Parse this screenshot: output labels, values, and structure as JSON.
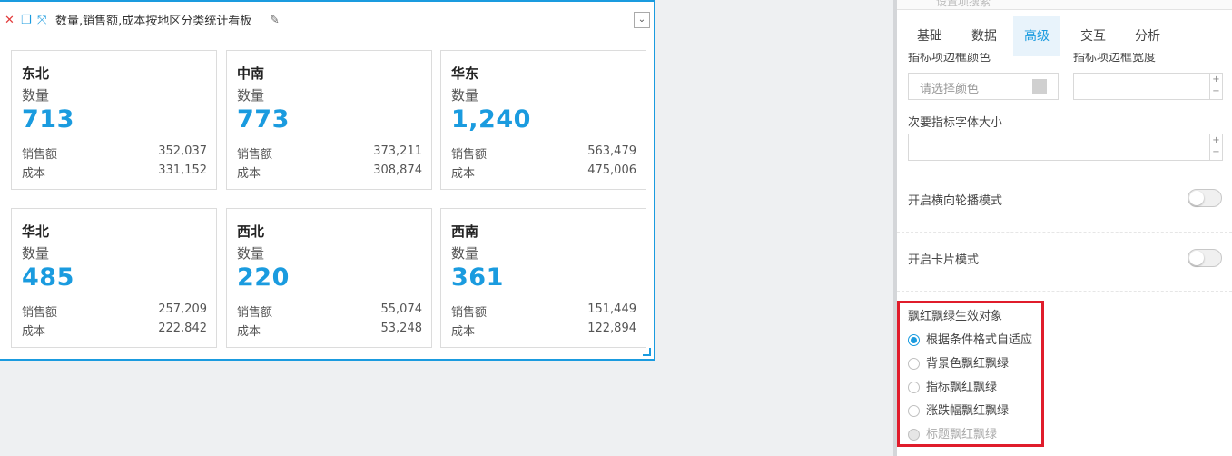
{
  "widget": {
    "title": "数量,销售额,成本按地区分类统计看板",
    "dropdown_glyph": "⌄",
    "cards": [
      {
        "region": "东北",
        "metric_label": "数量",
        "value": "713",
        "row1_label": "销售额",
        "row1_value": "352,037",
        "row2_label": "成本",
        "row2_value": "331,152"
      },
      {
        "region": "中南",
        "metric_label": "数量",
        "value": "773",
        "row1_label": "销售额",
        "row1_value": "373,211",
        "row2_label": "成本",
        "row2_value": "308,874"
      },
      {
        "region": "华东",
        "metric_label": "数量",
        "value": "1,240",
        "row1_label": "销售额",
        "row1_value": "563,479",
        "row2_label": "成本",
        "row2_value": "475,006"
      },
      {
        "region": "华北",
        "metric_label": "数量",
        "value": "485",
        "row1_label": "销售额",
        "row1_value": "257,209",
        "row2_label": "成本",
        "row2_value": "222,842"
      },
      {
        "region": "西北",
        "metric_label": "数量",
        "value": "220",
        "row1_label": "销售额",
        "row1_value": "55,074",
        "row2_label": "成本",
        "row2_value": "53,248"
      },
      {
        "region": "西南",
        "metric_label": "数量",
        "value": "361",
        "row1_label": "销售额",
        "row1_value": "151,449",
        "row2_label": "成本",
        "row2_value": "122,894"
      }
    ]
  },
  "panel": {
    "search_placeholder": "设置项搜索",
    "tabs": [
      "基础",
      "数据",
      "高级",
      "交互",
      "分析"
    ],
    "active_tab": "高级",
    "border_color_label": "指标项边框颜色",
    "border_width_label": "指标项边框宽度",
    "color_placeholder": "请选择颜色",
    "secondary_font_label": "次要指标字体大小",
    "spinner_up": "+",
    "spinner_down": "−",
    "carousel_label": "开启横向轮播模式",
    "card_mode_label": "开启卡片模式",
    "red_green_title": "飘红飘绿生效对象",
    "red_green_options": [
      {
        "label": "根据条件格式自适应",
        "state": "checked"
      },
      {
        "label": "背景色飘红飘绿",
        "state": "unchecked"
      },
      {
        "label": "指标飘红飘绿",
        "state": "unchecked"
      },
      {
        "label": "涨跌幅飘红飘绿",
        "state": "unchecked"
      },
      {
        "label": "标题飘红飘绿",
        "state": "disabled"
      }
    ]
  },
  "colors": {
    "accent": "#1a9bdf",
    "highlight_border": "#e01c2b",
    "close_icon": "#e23b3b"
  }
}
